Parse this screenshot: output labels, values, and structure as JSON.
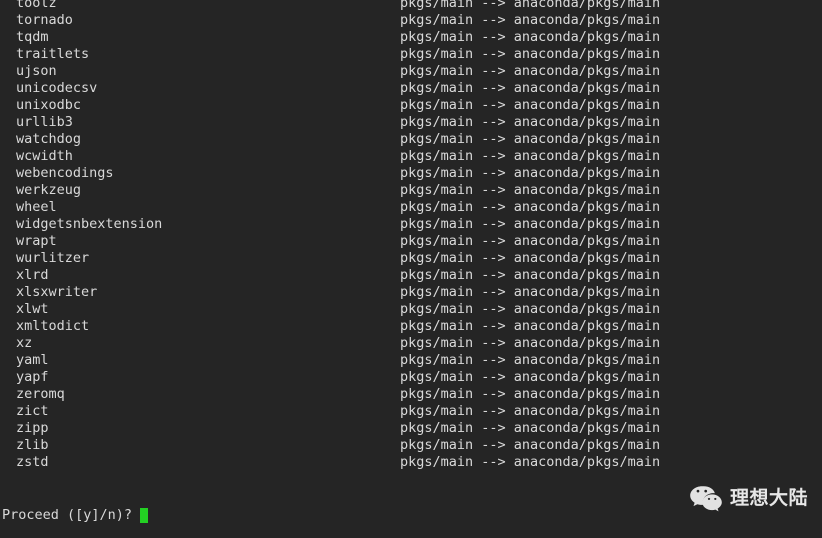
{
  "terminal": {
    "background_color": "#252525",
    "foreground_color": "#d9d9d9",
    "cursor_color": "#23d023"
  },
  "package_transfers": {
    "channel_mapping": "pkgs/main --> anaconda/pkgs/main",
    "rows": [
      {
        "name": "toolz",
        "channel": "pkgs/main --> anaconda/pkgs/main"
      },
      {
        "name": "tornado",
        "channel": "pkgs/main --> anaconda/pkgs/main"
      },
      {
        "name": "tqdm",
        "channel": "pkgs/main --> anaconda/pkgs/main"
      },
      {
        "name": "traitlets",
        "channel": "pkgs/main --> anaconda/pkgs/main"
      },
      {
        "name": "ujson",
        "channel": "pkgs/main --> anaconda/pkgs/main"
      },
      {
        "name": "unicodecsv",
        "channel": "pkgs/main --> anaconda/pkgs/main"
      },
      {
        "name": "unixodbc",
        "channel": "pkgs/main --> anaconda/pkgs/main"
      },
      {
        "name": "urllib3",
        "channel": "pkgs/main --> anaconda/pkgs/main"
      },
      {
        "name": "watchdog",
        "channel": "pkgs/main --> anaconda/pkgs/main"
      },
      {
        "name": "wcwidth",
        "channel": "pkgs/main --> anaconda/pkgs/main"
      },
      {
        "name": "webencodings",
        "channel": "pkgs/main --> anaconda/pkgs/main"
      },
      {
        "name": "werkzeug",
        "channel": "pkgs/main --> anaconda/pkgs/main"
      },
      {
        "name": "wheel",
        "channel": "pkgs/main --> anaconda/pkgs/main"
      },
      {
        "name": "widgetsnbextension",
        "channel": "pkgs/main --> anaconda/pkgs/main"
      },
      {
        "name": "wrapt",
        "channel": "pkgs/main --> anaconda/pkgs/main"
      },
      {
        "name": "wurlitzer",
        "channel": "pkgs/main --> anaconda/pkgs/main"
      },
      {
        "name": "xlrd",
        "channel": "pkgs/main --> anaconda/pkgs/main"
      },
      {
        "name": "xlsxwriter",
        "channel": "pkgs/main --> anaconda/pkgs/main"
      },
      {
        "name": "xlwt",
        "channel": "pkgs/main --> anaconda/pkgs/main"
      },
      {
        "name": "xmltodict",
        "channel": "pkgs/main --> anaconda/pkgs/main"
      },
      {
        "name": "xz",
        "channel": "pkgs/main --> anaconda/pkgs/main"
      },
      {
        "name": "yaml",
        "channel": "pkgs/main --> anaconda/pkgs/main"
      },
      {
        "name": "yapf",
        "channel": "pkgs/main --> anaconda/pkgs/main"
      },
      {
        "name": "zeromq",
        "channel": "pkgs/main --> anaconda/pkgs/main"
      },
      {
        "name": "zict",
        "channel": "pkgs/main --> anaconda/pkgs/main"
      },
      {
        "name": "zipp",
        "channel": "pkgs/main --> anaconda/pkgs/main"
      },
      {
        "name": "zlib",
        "channel": "pkgs/main --> anaconda/pkgs/main"
      },
      {
        "name": "zstd",
        "channel": "pkgs/main --> anaconda/pkgs/main"
      }
    ]
  },
  "prompt": {
    "text": "Proceed ([y]/n)?",
    "input_value": ""
  },
  "watermark": {
    "icon": "wechat-icon",
    "label": "理想大陆"
  }
}
